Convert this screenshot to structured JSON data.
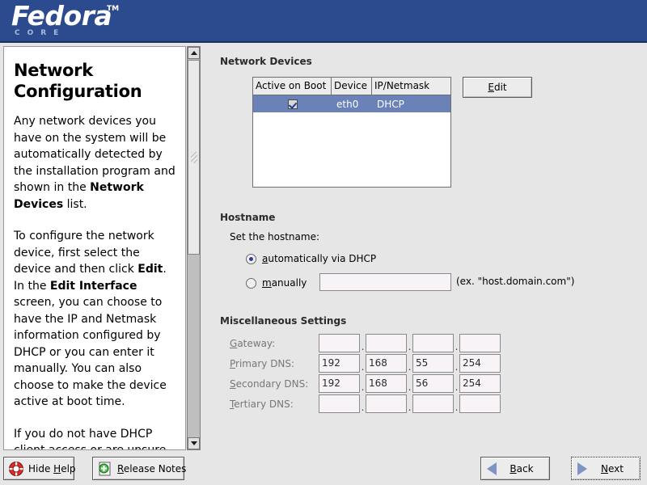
{
  "header": {
    "logo_text": "Fedora",
    "logo_tm": "TM",
    "logo_sub": "CORE",
    "bg_color": "#2c4b8e"
  },
  "help": {
    "title": "Network Configuration",
    "paragraphs": [
      "Any network devices you have on the system will be automatically detected by the installation program and shown in the Network Devices list.",
      "To configure the network device, first select the device and then click Edit. In the Edit Interface screen, you can choose to have the IP and Netmask information configured by DHCP or you can enter it manually. You can also choose to make the device active at boot time.",
      "If you do not have DHCP client access or are unsure as to"
    ],
    "scroll_up_icon": "triangle-up-icon",
    "scroll_down_icon": "triangle-down-icon"
  },
  "devices": {
    "section_title": "Network Devices",
    "columns": [
      "Active on Boot",
      "Device",
      "IP/Netmask"
    ],
    "rows": [
      {
        "active": true,
        "device": "eth0",
        "ipnetmask": "DHCP",
        "selected": true
      }
    ],
    "edit_label": "Edit",
    "selected_color": "#6a82b8"
  },
  "hostname": {
    "section_title": "Hostname",
    "prompt": "Set the hostname:",
    "option_dhcp": "automatically via DHCP",
    "option_manual": "manually",
    "selected_option": "automatically via DHCP",
    "input_value": "",
    "input_placeholder": "",
    "example_text": "(ex. \"host.domain.com\")"
  },
  "misc": {
    "section_title": "Miscellaneous Settings",
    "rows": [
      {
        "label": "Gateway:",
        "octets": [
          "",
          "",
          "",
          ""
        ]
      },
      {
        "label": "Primary DNS:",
        "octets": [
          "192",
          "168",
          "55",
          "254"
        ]
      },
      {
        "label": "Secondary DNS:",
        "octets": [
          "192",
          "168",
          "56",
          "254"
        ]
      },
      {
        "label": "Tertiary DNS:",
        "octets": [
          "",
          "",
          "",
          ""
        ]
      }
    ],
    "separator": "."
  },
  "bottom": {
    "hide_help": "Hide Help",
    "hide_help_icon": "lifesaver-icon",
    "release_notes": "Release Notes",
    "release_notes_icon": "document-plus-icon",
    "back": "Back",
    "back_icon": "arrow-left-icon",
    "next": "Next",
    "next_icon": "arrow-right-icon"
  }
}
